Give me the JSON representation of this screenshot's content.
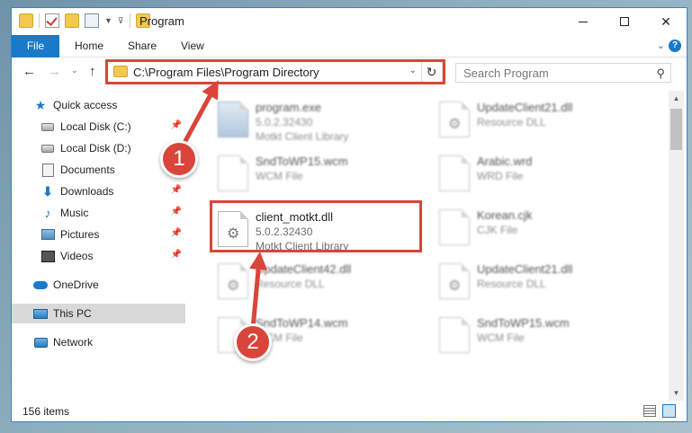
{
  "window": {
    "title": "Program"
  },
  "ribbon": {
    "tabs": [
      "File",
      "Home",
      "Share",
      "View"
    ],
    "help": "?"
  },
  "address": {
    "path": "C:\\Program Files\\Program Directory",
    "search_placeholder": "Search Program"
  },
  "sidebar": {
    "items": [
      {
        "label": "Quick access",
        "icon": "star-icon",
        "pinned": false
      },
      {
        "label": "Local Disk (C:)",
        "icon": "drive-icon",
        "pinned": true
      },
      {
        "label": "Local Disk (D:)",
        "icon": "drive-icon",
        "pinned": false
      },
      {
        "label": "Documents",
        "icon": "documents-icon",
        "pinned": true
      },
      {
        "label": "Downloads",
        "icon": "download-icon",
        "pinned": true
      },
      {
        "label": "Music",
        "icon": "music-icon",
        "pinned": true
      },
      {
        "label": "Pictures",
        "icon": "pictures-icon",
        "pinned": true
      },
      {
        "label": "Videos",
        "icon": "videos-icon",
        "pinned": true
      },
      {
        "label": "OneDrive",
        "icon": "cloud-icon",
        "pinned": false
      },
      {
        "label": "This PC",
        "icon": "computer-icon",
        "pinned": false,
        "selected": true
      },
      {
        "label": "Network",
        "icon": "network-icon",
        "pinned": false
      }
    ]
  },
  "files": [
    {
      "name": "program.exe",
      "line2": "5.0.2.32430",
      "line3": "Motkt Client Library",
      "type": "exe"
    },
    {
      "name": "UpdateClient21.dll",
      "line2": "Resource DLL",
      "line3": "",
      "type": "dll"
    },
    {
      "name": "SndToWP15.wcm",
      "line2": "WCM File",
      "line3": "",
      "type": "doc"
    },
    {
      "name": "Arabic.wrd",
      "line2": "WRD File",
      "line3": "",
      "type": "doc"
    },
    {
      "name": "client_motkt.dll",
      "line2": "5.0.2.32430",
      "line3": "Motkt Client Library",
      "type": "dll"
    },
    {
      "name": "Korean.cjk",
      "line2": "CJK File",
      "line3": "",
      "type": "doc"
    },
    {
      "name": "UpdateClient42.dll",
      "line2": "Resource DLL",
      "line3": "",
      "type": "dll"
    },
    {
      "name": "UpdateClient21.dll",
      "line2": "Resource DLL",
      "line3": "",
      "type": "dll"
    },
    {
      "name": "SndToWP14.wcm",
      "line2": "WCM File",
      "line3": "",
      "type": "doc"
    },
    {
      "name": "SndToWP15.wcm",
      "line2": "WCM File",
      "line3": "",
      "type": "doc"
    }
  ],
  "status": {
    "count": "156 items"
  },
  "annotations": {
    "step1": "1",
    "step2": "2",
    "color": "#d9453a"
  }
}
